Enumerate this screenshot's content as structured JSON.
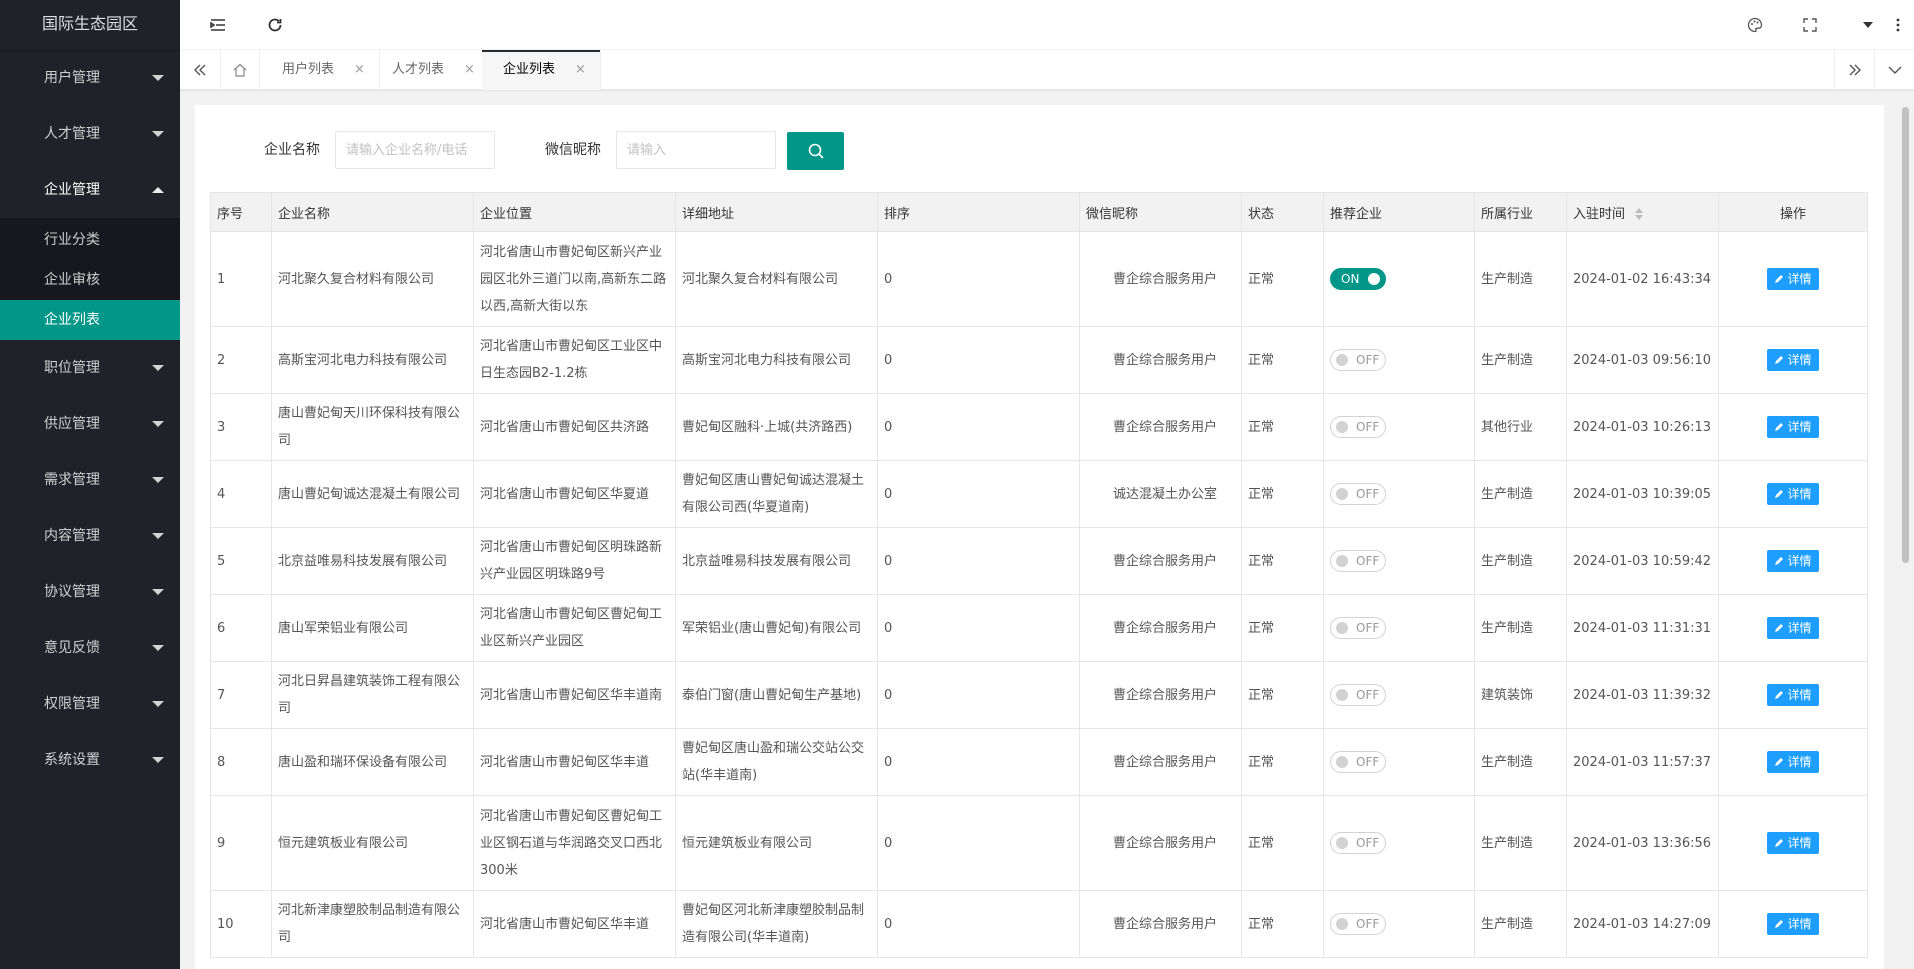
{
  "sidebar": {
    "logo": "国际生态园区",
    "menu": [
      {
        "label": "用户管理"
      },
      {
        "label": "人才管理"
      },
      {
        "label": "企业管理",
        "open": true,
        "children": [
          {
            "label": "行业分类"
          },
          {
            "label": "企业审核"
          },
          {
            "label": "企业列表",
            "active": true
          }
        ]
      },
      {
        "label": "职位管理"
      },
      {
        "label": "供应管理"
      },
      {
        "label": "需求管理"
      },
      {
        "label": "内容管理"
      },
      {
        "label": "协议管理"
      },
      {
        "label": "意见反馈"
      },
      {
        "label": "权限管理"
      },
      {
        "label": "系统设置"
      }
    ]
  },
  "tabs": [
    {
      "label": "用户列表",
      "close": "×"
    },
    {
      "label": "人才列表",
      "close": "×"
    },
    {
      "label": "企业列表",
      "close": "×",
      "active": true
    }
  ],
  "search": {
    "company_label": "企业名称",
    "company_placeholder": "请输入企业名称/电话",
    "wechat_label": "微信昵称",
    "wechat_placeholder": "请输入"
  },
  "table": {
    "headers": [
      "序号",
      "企业名称",
      "企业位置",
      "详细地址",
      "排序",
      "微信昵称",
      "状态",
      "推荐企业",
      "所属行业",
      "入驻时间",
      "操作"
    ],
    "switch_on": "ON",
    "switch_off": "OFF",
    "detail_label": "详情",
    "rows": [
      {
        "no": "1",
        "name": "河北聚久复合材料有限公司",
        "location": "河北省唐山市曹妃甸区新兴产业园区北外三道门以南,高新东二路以西,高新大街以东",
        "address": "河北聚久复合材料有限公司",
        "sort": "0",
        "nick": "曹企综合服务用户",
        "status": "正常",
        "recommend": true,
        "industry": "生产制造",
        "time": "2024-01-02 16:43:34"
      },
      {
        "no": "2",
        "name": "高斯宝河北电力科技有限公司",
        "location": "河北省唐山市曹妃甸区工业区中日生态园B2-1.2栋",
        "address": "高斯宝河北电力科技有限公司",
        "sort": "0",
        "nick": "曹企综合服务用户",
        "status": "正常",
        "recommend": false,
        "industry": "生产制造",
        "time": "2024-01-03 09:56:10"
      },
      {
        "no": "3",
        "name": "唐山曹妃甸天川环保科技有限公司",
        "location": "河北省唐山市曹妃甸区共济路",
        "address": "曹妃甸区融科·上城(共济路西)",
        "sort": "0",
        "nick": "曹企综合服务用户",
        "status": "正常",
        "recommend": false,
        "industry": "其他行业",
        "time": "2024-01-03 10:26:13"
      },
      {
        "no": "4",
        "name": "唐山曹妃甸诚达混凝土有限公司",
        "location": "河北省唐山市曹妃甸区华夏道",
        "address": "曹妃甸区唐山曹妃甸诚达混凝土有限公司西(华夏道南)",
        "sort": "0",
        "nick": "诚达混凝土办公室",
        "status": "正常",
        "recommend": false,
        "industry": "生产制造",
        "time": "2024-01-03 10:39:05"
      },
      {
        "no": "5",
        "name": "北京益唯易科技发展有限公司",
        "location": "河北省唐山市曹妃甸区明珠路新兴产业园区明珠路9号",
        "address": "北京益唯易科技发展有限公司",
        "sort": "0",
        "nick": "曹企综合服务用户",
        "status": "正常",
        "recommend": false,
        "industry": "生产制造",
        "time": "2024-01-03 10:59:42"
      },
      {
        "no": "6",
        "name": "唐山军荣铝业有限公司",
        "location": "河北省唐山市曹妃甸区曹妃甸工业区新兴产业园区",
        "address": "军荣铝业(唐山曹妃甸)有限公司",
        "sort": "0",
        "nick": "曹企综合服务用户",
        "status": "正常",
        "recommend": false,
        "industry": "生产制造",
        "time": "2024-01-03 11:31:31"
      },
      {
        "no": "7",
        "name": "河北日昇昌建筑装饰工程有限公司",
        "location": "河北省唐山市曹妃甸区华丰道南",
        "address": "泰伯门窗(唐山曹妃甸生产基地)",
        "sort": "0",
        "nick": "曹企综合服务用户",
        "status": "正常",
        "recommend": false,
        "industry": "建筑装饰",
        "time": "2024-01-03 11:39:32"
      },
      {
        "no": "8",
        "name": "唐山盈和瑞环保设备有限公司",
        "location": "河北省唐山市曹妃甸区华丰道",
        "address": "曹妃甸区唐山盈和瑞公交站公交站(华丰道南)",
        "sort": "0",
        "nick": "曹企综合服务用户",
        "status": "正常",
        "recommend": false,
        "industry": "生产制造",
        "time": "2024-01-03 11:57:37"
      },
      {
        "no": "9",
        "name": "恒元建筑板业有限公司",
        "location": "河北省唐山市曹妃甸区曹妃甸工业区钢石道与华润路交叉口西北300米",
        "address": "恒元建筑板业有限公司",
        "sort": "0",
        "nick": "曹企综合服务用户",
        "status": "正常",
        "recommend": false,
        "industry": "生产制造",
        "time": "2024-01-03 13:36:56"
      },
      {
        "no": "10",
        "name": "河北新津康塑胶制品制造有限公司",
        "location": "河北省唐山市曹妃甸区华丰道",
        "address": "曹妃甸区河北新津康塑胶制品制造有限公司(华丰道南)",
        "sort": "0",
        "nick": "曹企综合服务用户",
        "status": "正常",
        "recommend": false,
        "industry": "生产制造",
        "time": "2024-01-03 14:27:09"
      }
    ]
  }
}
